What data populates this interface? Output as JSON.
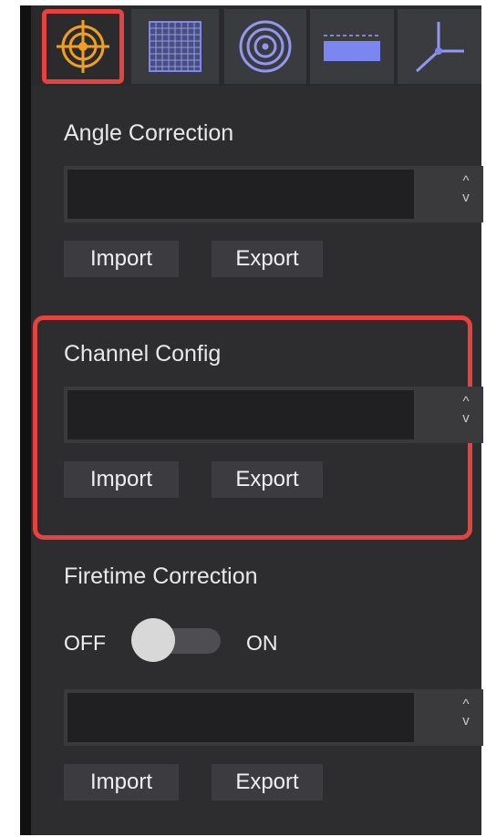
{
  "toolbar": {
    "tools": [
      {
        "icon": "crosshair-target-icon",
        "selected": true
      },
      {
        "icon": "grid-icon",
        "selected": false
      },
      {
        "icon": "concentric-circles-icon",
        "selected": false
      },
      {
        "icon": "ruler-bar-icon",
        "selected": false
      },
      {
        "icon": "axis-tripod-icon",
        "selected": false
      }
    ],
    "highlight_color": "#e8423e",
    "accent_orange": "#f0a020",
    "accent_blue": "#7b86f0"
  },
  "angle_correction": {
    "title": "Angle Correction",
    "value": "",
    "spinner_up": "^",
    "spinner_down": "v",
    "import_label": "Import",
    "export_label": "Export"
  },
  "channel_config": {
    "title": "Channel Config",
    "value": "",
    "spinner_up": "^",
    "spinner_down": "v",
    "import_label": "Import",
    "export_label": "Export"
  },
  "firetime_correction": {
    "title": "Firetime Correction",
    "toggle_off_label": "OFF",
    "toggle_on_label": "ON",
    "toggle_state": "off",
    "value": "",
    "spinner_up": "^",
    "spinner_down": "v",
    "import_label": "Import",
    "export_label": "Export"
  }
}
